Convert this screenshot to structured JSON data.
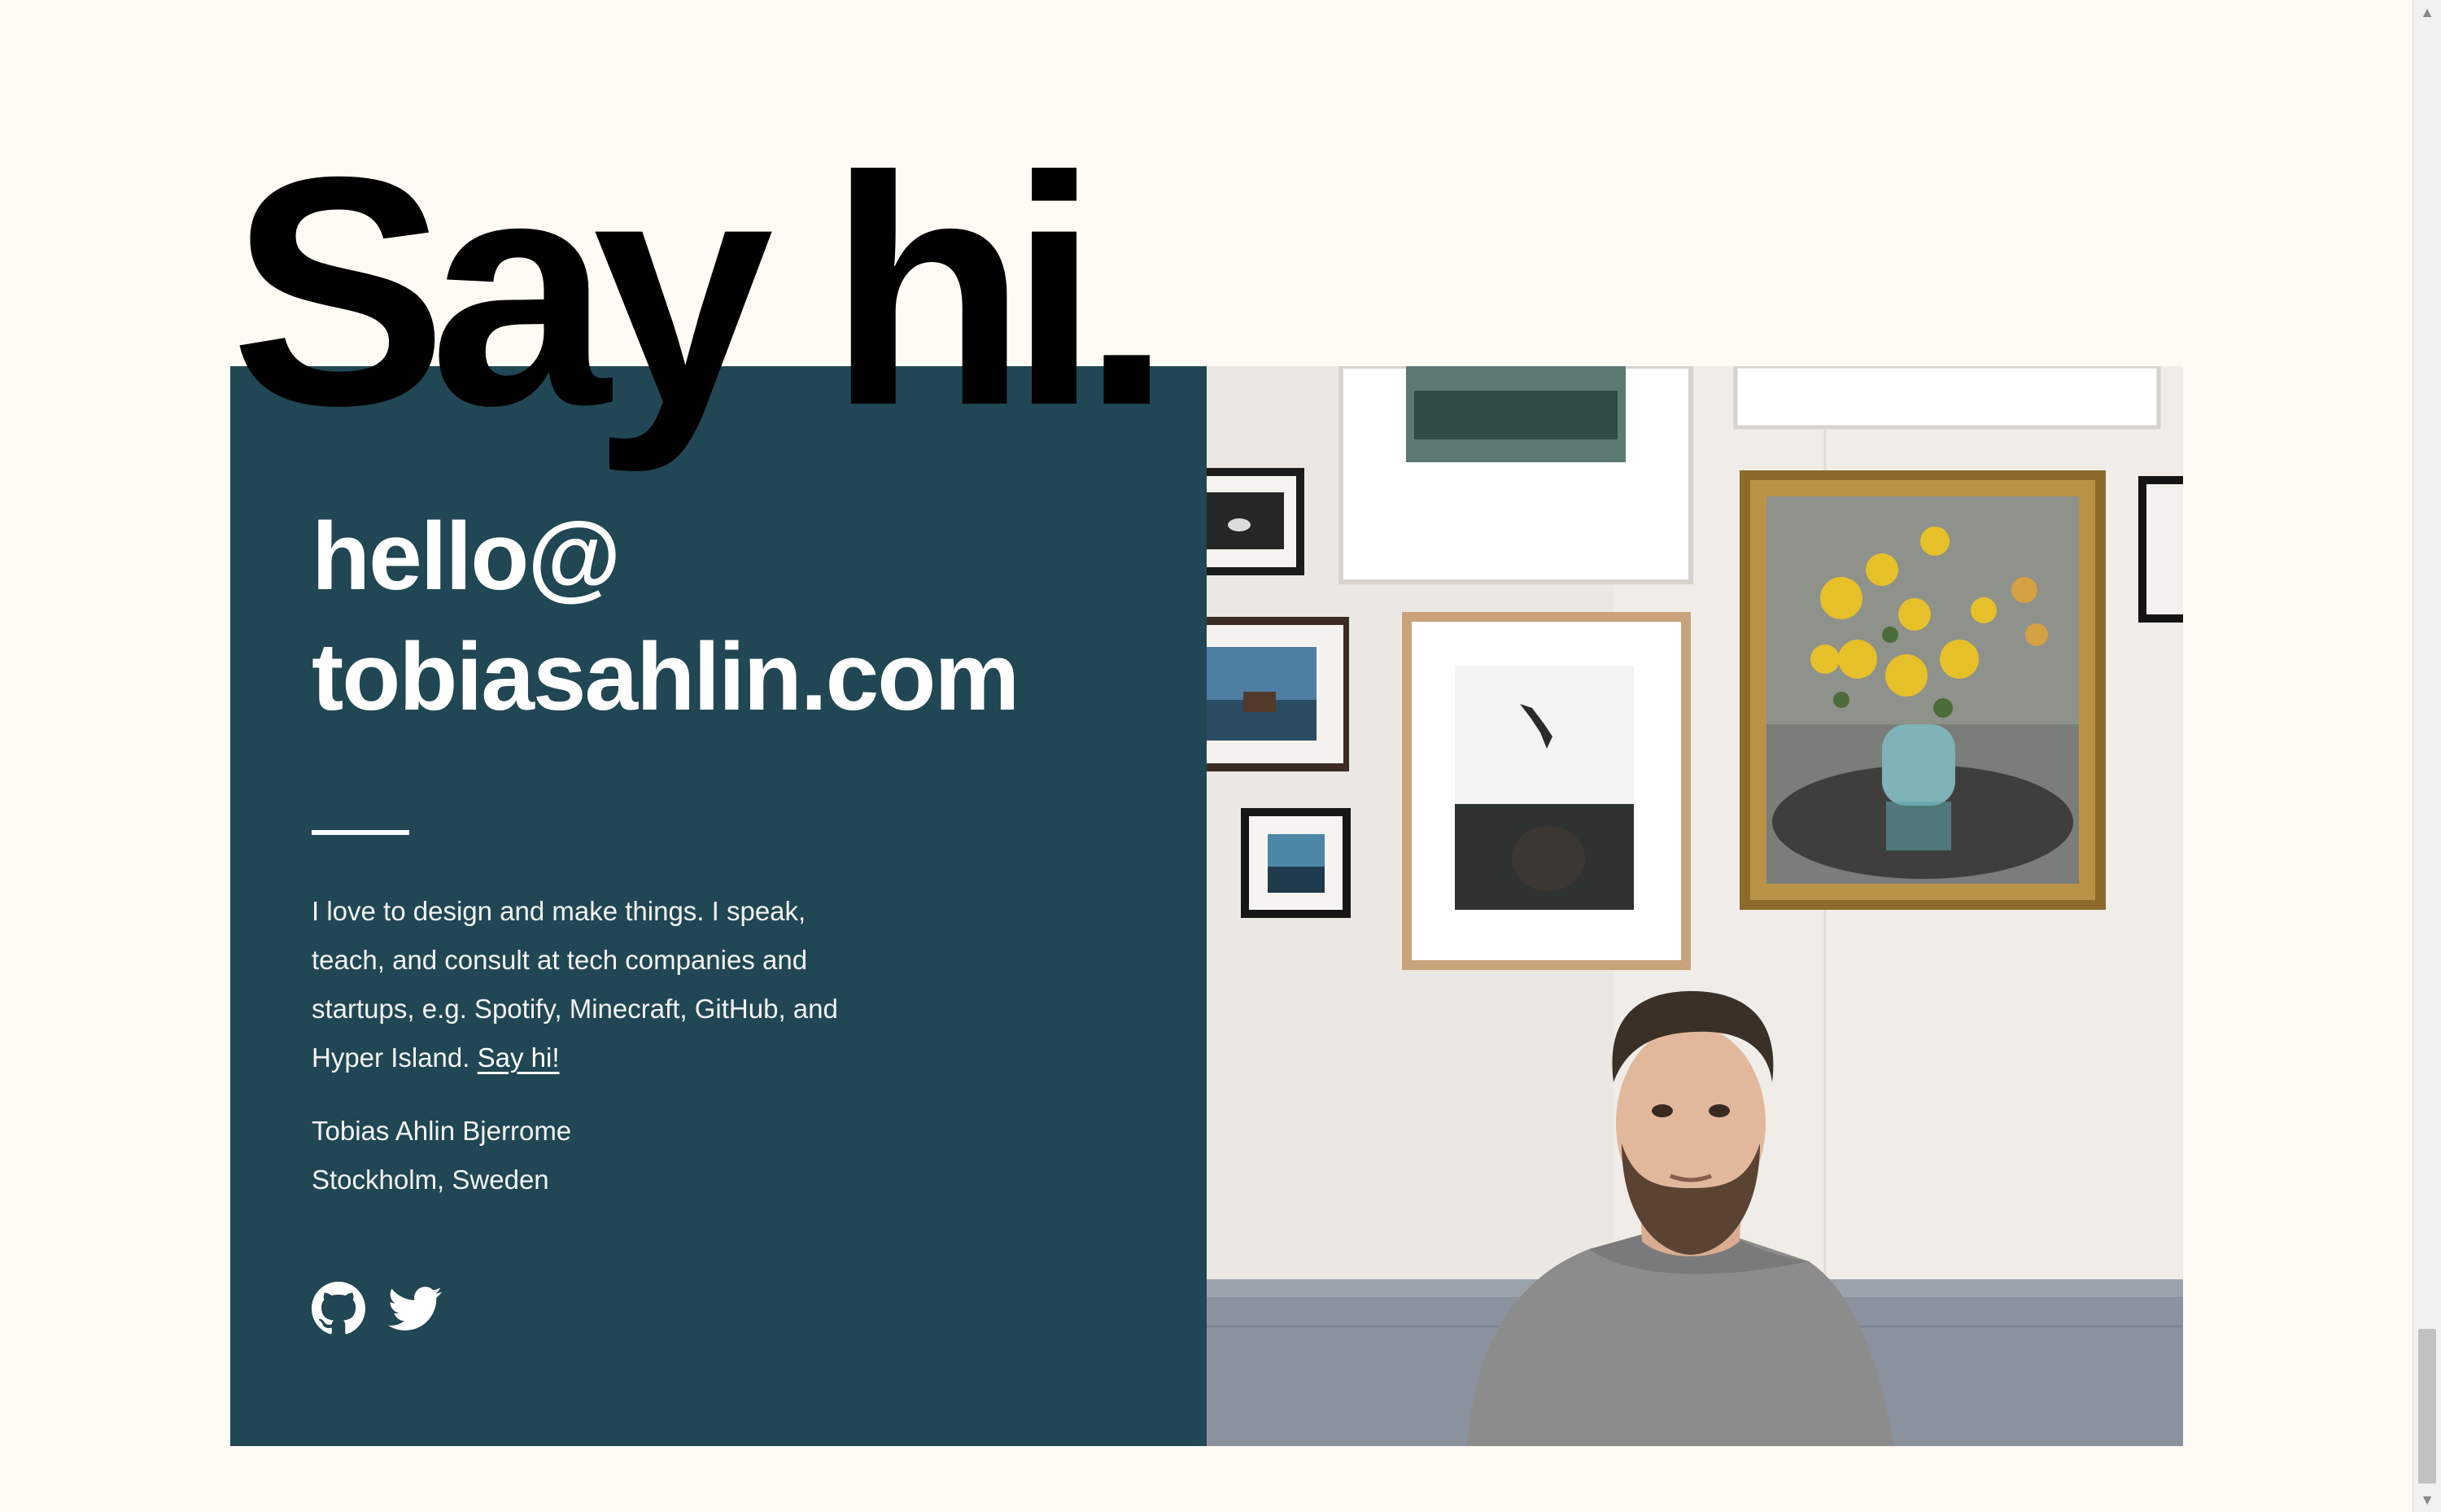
{
  "headline": "Say hi.",
  "contact_card": {
    "email_line1": "hello@",
    "email_line2": "tobiasahlin.com",
    "bio_text": "I love to design and make things. I speak, teach, and consult at tech companies and startups, e.g. Spotify, Minecraft, GitHub, and Hyper Island.",
    "bio_link": "Say hi!",
    "name": "Tobias Ahlin Bjerrome",
    "location": "Stockholm, Sweden",
    "socials": [
      {
        "icon": "github-icon"
      },
      {
        "icon": "twitter-icon"
      }
    ]
  },
  "colors": {
    "background": "#fdfbf3",
    "panel": "#214654",
    "text_light": "#ffffff",
    "headline": "#000000"
  }
}
